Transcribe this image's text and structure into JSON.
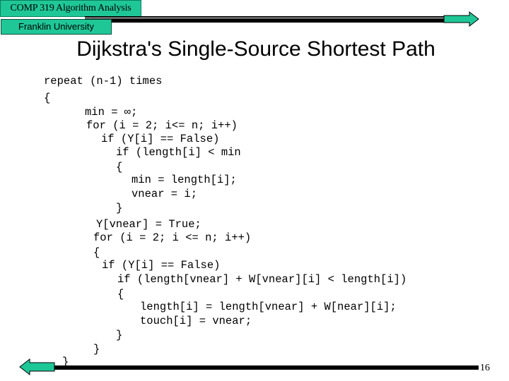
{
  "header": {
    "course": "COMP 319 Algorithm Analysis",
    "university": "Franklin University"
  },
  "slide": {
    "title": "Dijkstra's Single-Source Shortest Path",
    "page_number": "16"
  },
  "code": {
    "lines": [
      "repeat (n-1) times",
      "{",
      "min = ∞;",
      "for (i = 2; i<= n; i++)",
      "if (Y[i] == False)",
      "if (length[i] < min",
      "{",
      "min = length[i];",
      "vnear = i;",
      "}",
      "Y[vnear] = True;",
      "for (i = 2; i <= n; i++)",
      "{",
      "if (Y[i] == False)",
      "if (length[vnear] + W[vnear][i] < length[i])",
      "{",
      "length[i] = length[vnear] + W[near][i];",
      "touch[i] = vnear;",
      "}",
      "}",
      "}"
    ]
  },
  "navigation": {
    "next_icon": "arrow-right-icon",
    "prev_icon": "arrow-left-icon"
  },
  "colors": {
    "accent": "#1fc797",
    "text": "#000000",
    "background": "#ffffff"
  }
}
